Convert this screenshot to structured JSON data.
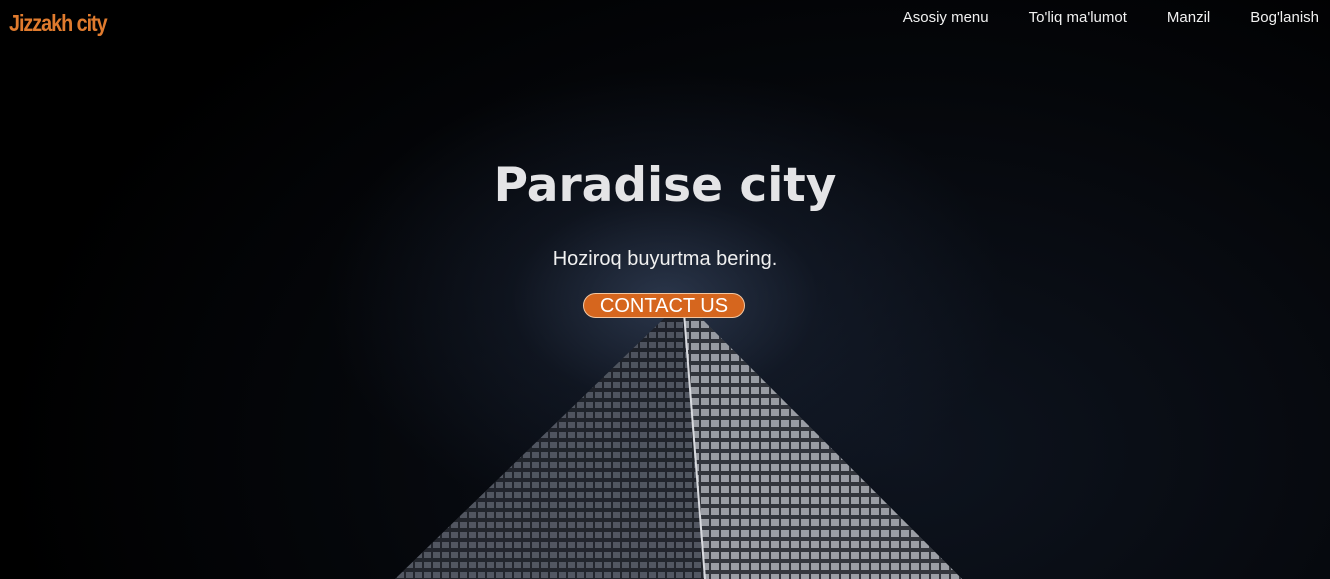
{
  "header": {
    "logo": "Jizzakh city",
    "nav": [
      "Asosiy menu",
      "To'liq ma'lumot",
      "Manzil",
      "Bog'lanish"
    ]
  },
  "hero": {
    "title": "Paradise city",
    "subtitle": "Hoziroq buyurtma bering.",
    "cta_label": "CONTACT US",
    "background_image": "night skyscraper viewed from below"
  },
  "colors": {
    "accent": "#d6661e",
    "logo": "#e07b2e",
    "text": "#f0f0f0",
    "background": "#000000"
  }
}
